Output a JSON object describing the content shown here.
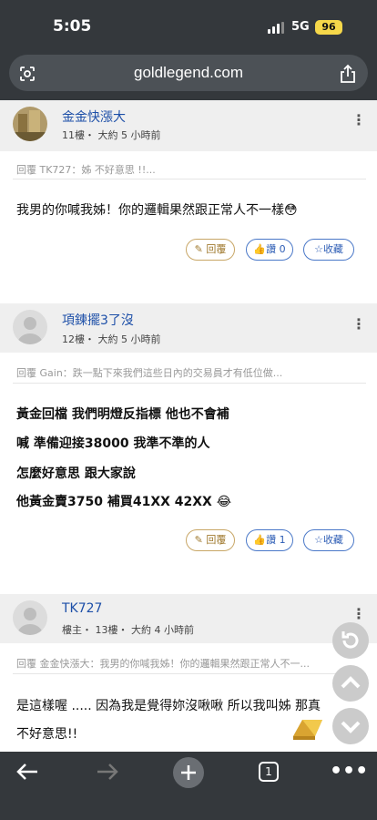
{
  "status": {
    "time": "5:05",
    "network": "5G",
    "battery": "96"
  },
  "browser": {
    "url": "goldlegend.com"
  },
  "posts": [
    {
      "author": "金金快漲大",
      "meta": "11樓・ 大約 5 小時前",
      "quote": "回覆 TK727：姊 不好意思 !!...",
      "lines": [
        "我男的你喊我姊！你的邏輯果然跟正常人不一樣😳"
      ],
      "reply_label": "✎ 回覆",
      "like_label": "讚 0",
      "fav_label": "收藏"
    },
    {
      "author": "項鍊擺3了沒",
      "meta": "12樓・ 大約 5 小時前",
      "quote": "回覆 Gain：跌一點下來我們這些日內的交易員才有低位做...",
      "lines": [
        "黃金回檔 我們明燈反指標 他也不會補",
        "喊 準備迎接38000 我準不準的人",
        "怎麼好意思 跟大家說",
        "他黃金賣3750 補買41XX 42XX 😂"
      ],
      "reply_label": "✎ 回覆",
      "like_label": "讚 1",
      "fav_label": "收藏"
    },
    {
      "author": "TK727",
      "meta": "樓主・ 13樓・ 大約 4 小時前",
      "quote": "回覆 金金快漲大：我男的你喊我姊！你的邏輯果然跟正常人不一...",
      "lines": [
        "是這樣喔 ..... 因為我是覺得妳沒啾啾 所以我叫姊 那真",
        "不好意思!!"
      ]
    }
  ],
  "tabs": {
    "count": "1"
  }
}
